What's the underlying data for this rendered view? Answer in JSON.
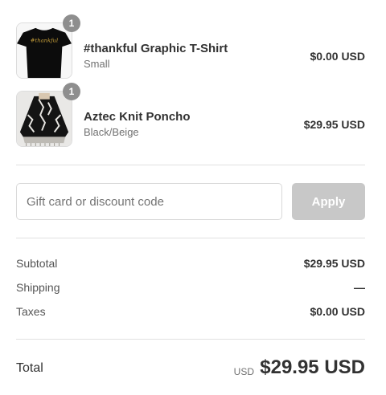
{
  "items": [
    {
      "name": "#thankful Graphic T-Shirt",
      "variant": "Small",
      "price": "$0.00 USD",
      "quantity": "1",
      "shirt_print": "#thankful",
      "image": "black-tshirt-image"
    },
    {
      "name": "Aztec Knit Poncho",
      "variant": "Black/Beige",
      "price": "$29.95 USD",
      "quantity": "1",
      "image": "aztec-poncho-image"
    }
  ],
  "discount": {
    "placeholder": "Gift card or discount code",
    "apply_label": "Apply"
  },
  "summary": {
    "subtotal_label": "Subtotal",
    "subtotal_value": "$29.95 USD",
    "shipping_label": "Shipping",
    "shipping_value": "—",
    "taxes_label": "Taxes",
    "taxes_value": "$0.00 USD"
  },
  "total": {
    "label": "Total",
    "currency": "USD",
    "amount": "$29.95 USD"
  },
  "colors": {
    "badge": "#8e8e8e",
    "apply_button": "#c8c8c8",
    "divider": "#e1e1e1",
    "text_primary": "#323232",
    "text_secondary": "#717171"
  }
}
